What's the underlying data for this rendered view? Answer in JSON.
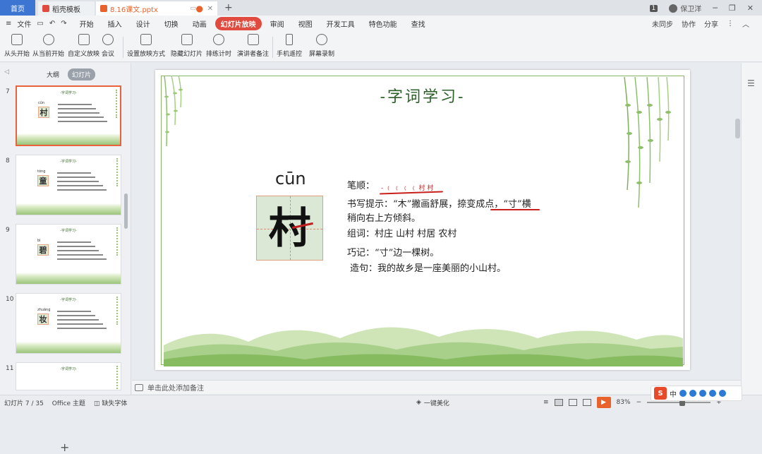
{
  "titlebar": {
    "home_tab": "首页",
    "daoke_tab": "稻壳模板",
    "file_tab": "8.16课文.pptx",
    "new_tab_icon": "+",
    "badge": "1",
    "user_name": "保卫洋"
  },
  "menubar": {
    "file_menu": "文件",
    "tabs": [
      "开始",
      "插入",
      "设计",
      "切换",
      "动画",
      "幻灯片放映",
      "审阅",
      "视图",
      "开发工具",
      "特色功能",
      "查找"
    ],
    "active_tab": "幻灯片放映",
    "right": [
      "未同步",
      "协作",
      "分享"
    ]
  },
  "toolbar": {
    "items": [
      "从头开始",
      "从当前开始",
      "自定义放映",
      "会议",
      "设置放映方式",
      "隐藏幻灯片",
      "排练计时",
      "演讲者备注",
      "手机遥控",
      "屏幕录制"
    ]
  },
  "leftpanel": {
    "tabs": [
      "大纲",
      "幻灯片"
    ],
    "active_tab": "幻灯片",
    "slides": [
      {
        "num": "7",
        "char": "村",
        "pinyin": "cūn"
      },
      {
        "num": "8",
        "char": "童",
        "pinyin": "tóng"
      },
      {
        "num": "9",
        "char": "碧",
        "pinyin": "bì"
      },
      {
        "num": "10",
        "char": "妆",
        "pinyin": "zhuāng"
      },
      {
        "num": "11",
        "char": "",
        "pinyin": ""
      }
    ],
    "thumb_title": "-字词学习-"
  },
  "slide": {
    "title": "-字词学习-",
    "pinyin": "cūn",
    "char": "村",
    "stroke_label": "笔顺：",
    "stroke_order": "- ﹙ ﹙ ﹙ ﹙ 村 村",
    "hint_line1": "书写提示：“木”撇画舒展，捺变成点，“寸”横",
    "hint_line2": "稍向右上方倾斜。",
    "words": "组词：村庄   山村   村居   农村",
    "memory": "巧记：“寸”边一棵树。",
    "sentence": "造句：我的故乡是一座美丽的小山村。"
  },
  "notes": {
    "placeholder": "单击此处添加备注"
  },
  "statusbar": {
    "slide_info": "幻灯片 7 / 35",
    "theme": "Office 主题",
    "font": "缺失字体",
    "beautify": "一键美化",
    "zoom": "83%"
  },
  "ime": {
    "lang": "中"
  }
}
